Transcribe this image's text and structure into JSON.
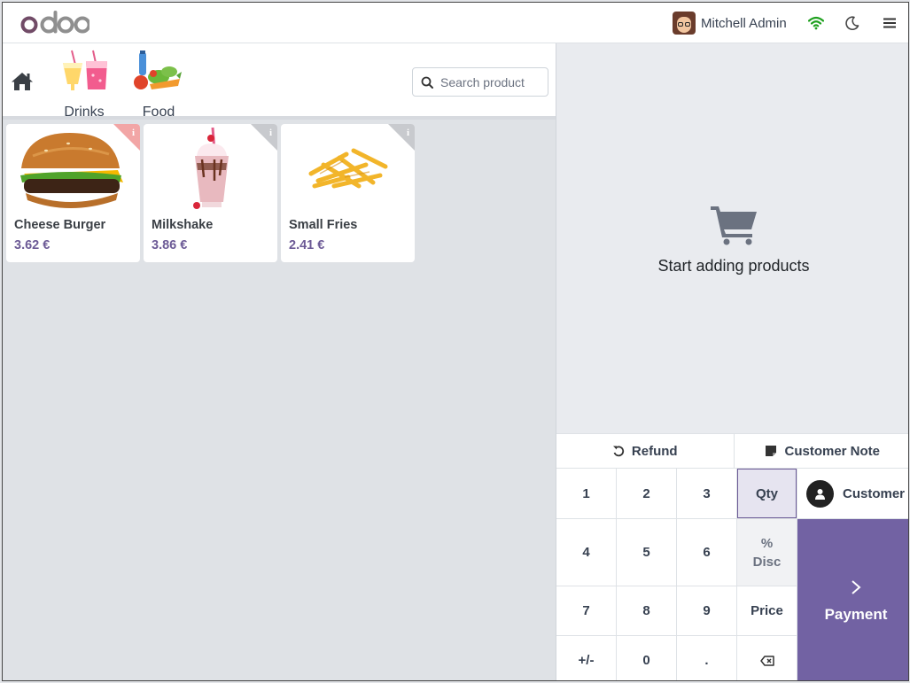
{
  "header": {
    "user_name": "Mitchell Admin"
  },
  "categories": [
    {
      "label": "Drinks"
    },
    {
      "label": "Food"
    }
  ],
  "search": {
    "placeholder": "Search product"
  },
  "products": [
    {
      "name": "Cheese Burger",
      "price": "3.62 €"
    },
    {
      "name": "Milkshake",
      "price": "3.86 €"
    },
    {
      "name": "Small Fries",
      "price": "2.41 €"
    }
  ],
  "order": {
    "empty_message": "Start adding products"
  },
  "actions": {
    "refund": "Refund",
    "customer_note": "Customer Note"
  },
  "numpad": {
    "k1": "1",
    "k2": "2",
    "k3": "3",
    "k4": "4",
    "k5": "5",
    "k6": "6",
    "k7": "7",
    "k8": "8",
    "k9": "9",
    "sign": "+/-",
    "k0": "0",
    "dot": ".",
    "qty": "Qty",
    "disc_symbol": "%",
    "disc": "Disc",
    "price": "Price",
    "customer": "Customer",
    "payment": "Payment"
  },
  "colors": {
    "brand": "#714B67",
    "accent": "#7262a3",
    "price": "#6c5a96",
    "online": "#1ea01e"
  },
  "icons": [
    "home-icon",
    "search-icon",
    "wifi-icon",
    "moon-icon",
    "menu-icon",
    "cart-icon",
    "undo-icon",
    "note-icon",
    "user-icon",
    "chevron-right-icon",
    "backspace-icon",
    "info-icon"
  ]
}
